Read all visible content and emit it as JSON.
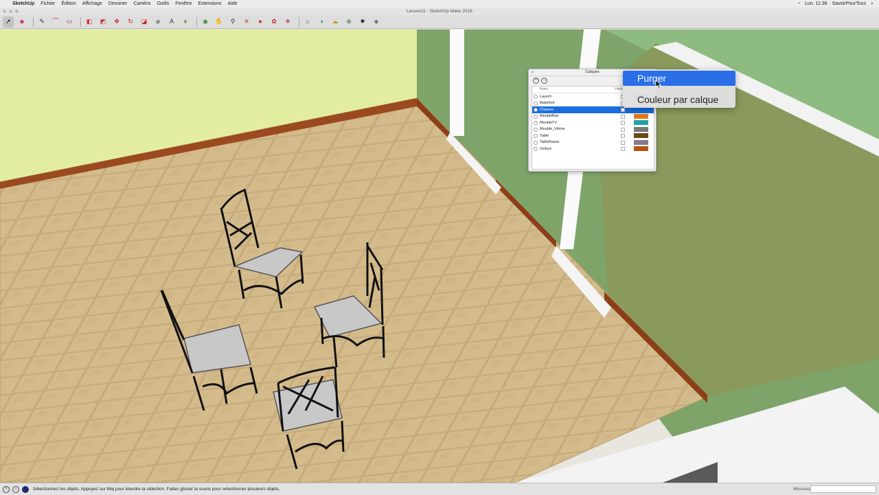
{
  "menubar": {
    "app": "SketchUp",
    "items": [
      "Fichier",
      "Édition",
      "Affichage",
      "Dessiner",
      "Caméra",
      "Outils",
      "Fenêtre",
      "Extensions",
      "Aide"
    ],
    "time": "Lun. 11:36",
    "user": "SavoirPourTous"
  },
  "window": {
    "title": "Lesson11 - SketchUp Make 2016"
  },
  "toolbar": {
    "icons": [
      "select-icon",
      "eraser-icon",
      "pencil-icon",
      "arc-icon",
      "rectangle-icon",
      "push-pull-icon",
      "follow-me-icon",
      "move-icon",
      "rotate-icon",
      "scale-icon",
      "tape-measure-icon",
      "text-icon",
      "paint-bucket-icon",
      "orbit-icon",
      "pan-icon",
      "zoom-icon",
      "zoom-extents-icon",
      "warehouse-icon",
      "extension-icon",
      "views-icon",
      "standard-views-icon",
      "shadows-icon",
      "fog-icon",
      "geo-icon",
      "styles-icon",
      "sandbox-icon"
    ]
  },
  "layers": {
    "title": "Calques",
    "col_name": "Nom",
    "col_visible": "Visible",
    "rows": [
      {
        "name": "Layer0",
        "color": "#1a6ee0",
        "selected": false
      },
      {
        "name": "Babyfoot",
        "color": "#ffffff",
        "selected": false
      },
      {
        "name": "Chaises",
        "color": "#1a6ee0",
        "selected": true
      },
      {
        "name": "MeubleBas",
        "color": "#e07b1a",
        "selected": false
      },
      {
        "name": "MeubleTV",
        "color": "#1fa3a3",
        "selected": false
      },
      {
        "name": "Meuble_Vitrine",
        "color": "#7a7a7a",
        "selected": false
      },
      {
        "name": "Table",
        "color": "#6b4a16",
        "selected": false
      },
      {
        "name": "TableBasse",
        "color": "#8a7a8a",
        "selected": false
      },
      {
        "name": "Voiture",
        "color": "#b55310",
        "selected": false
      }
    ]
  },
  "context_menu": {
    "items": [
      "Purger",
      "Couleur par calque"
    ],
    "highlighted": "Purger"
  },
  "statusbar": {
    "message": "Sélectionnez les objets. Appuyez sur Maj pour étendre la sélection. Faites glisser la souris pour sélectionner plusieurs objets.",
    "measure_label": "Mesures"
  }
}
